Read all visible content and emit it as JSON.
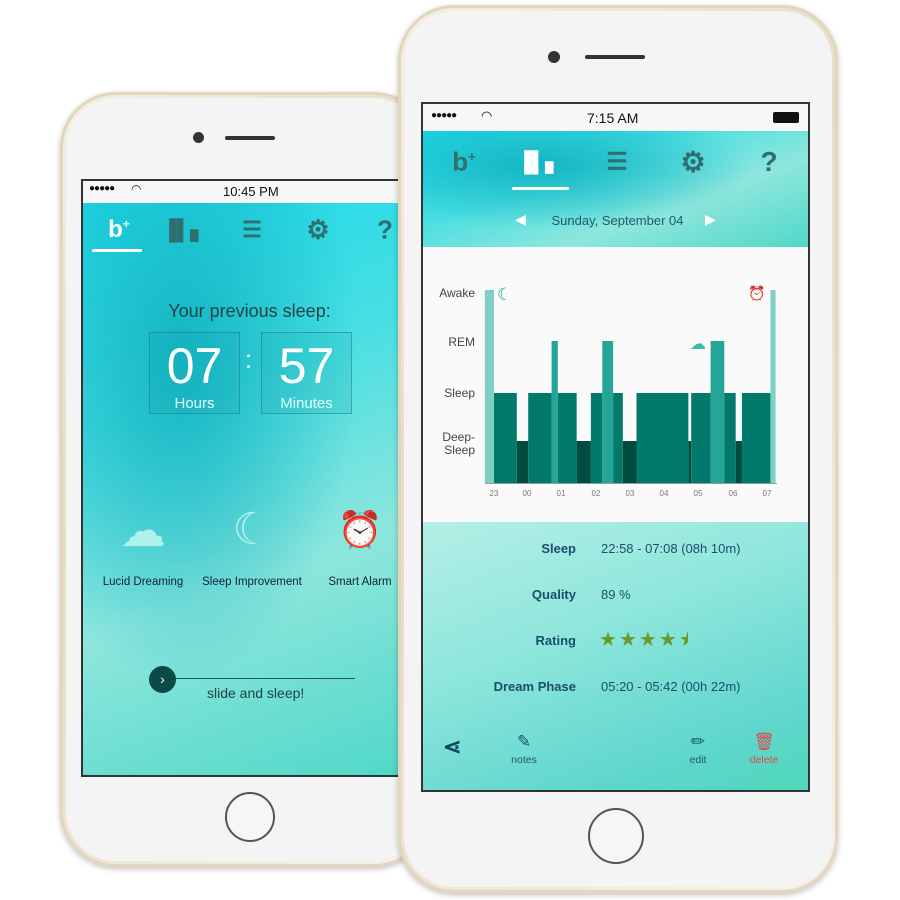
{
  "left_phone": {
    "status": {
      "time": "10:45 PM"
    },
    "nav": [
      "home-plus",
      "stats",
      "list",
      "settings",
      "help"
    ],
    "active_nav": "home-plus",
    "heading": "Your previous sleep:",
    "hours": {
      "value": "07",
      "label": "Hours"
    },
    "minutes": {
      "value": "57",
      "label": "Minutes"
    },
    "features": [
      {
        "label": "Lucid Dreaming",
        "icon": "cloud-icon"
      },
      {
        "label": "Sleep Improvement",
        "icon": "moon-icon"
      },
      {
        "label": "Smart Alarm",
        "icon": "alarm-clock-icon"
      }
    ],
    "slider_label": "slide and sleep!"
  },
  "right_phone": {
    "status": {
      "time": "7:15 AM"
    },
    "active_nav": "stats",
    "date": "Sunday, September 04",
    "chart": {
      "y_labels": [
        "Awake",
        "REM",
        "Sleep",
        "Deep-\nSleep"
      ],
      "x_labels": [
        "23",
        "00",
        "01",
        "02",
        "03",
        "04",
        "05",
        "06",
        "07"
      ],
      "colors": {
        "Awake": "#7fcfc4",
        "REM": "#25a597",
        "Sleep": "#017a6c",
        "Deep": "#004d40"
      }
    },
    "stats": [
      {
        "label": "Sleep",
        "value": "22:58 - 07:08  (08h 10m)"
      },
      {
        "label": "Quality",
        "value": "89 %"
      },
      {
        "label": "Rating",
        "value": "",
        "stars": 4.5
      },
      {
        "label": "Dream Phase",
        "value": "05:20 - 05:42  (00h 22m)"
      }
    ],
    "toolbar": {
      "notes": "notes",
      "edit": "edit",
      "delete": "delete"
    },
    "accent": {
      "stars": "#6a9a2a",
      "delete": "#e04848"
    }
  },
  "chart_data": {
    "type": "bar",
    "x_unit": "clock time",
    "categories": [
      "Awake",
      "REM",
      "Sleep",
      "Deep-Sleep"
    ],
    "segments": [
      [
        "22:44",
        "23:00",
        "Awake"
      ],
      [
        "23:00",
        "23:40",
        "Sleep"
      ],
      [
        "23:40",
        "00:00",
        "Deep"
      ],
      [
        "00:00",
        "00:41",
        "Sleep"
      ],
      [
        "00:41",
        "00:52",
        "REM"
      ],
      [
        "00:52",
        "01:25",
        "Sleep"
      ],
      [
        "01:25",
        "01:50",
        "Deep"
      ],
      [
        "01:50",
        "02:10",
        "Sleep"
      ],
      [
        "02:10",
        "02:29",
        "REM"
      ],
      [
        "02:29",
        "02:46",
        "Sleep"
      ],
      [
        "02:46",
        "03:10",
        "Deep"
      ],
      [
        "03:10",
        "04:41",
        "Sleep"
      ],
      [
        "04:41",
        "04:46",
        "Deep"
      ],
      [
        "04:46",
        "05:20",
        "Sleep"
      ],
      [
        "05:20",
        "05:44",
        "REM"
      ],
      [
        "05:44",
        "06:04",
        "Sleep"
      ],
      [
        "06:04",
        "06:15",
        "Deep"
      ],
      [
        "06:15",
        "07:05",
        "Sleep"
      ],
      [
        "07:05",
        "07:14",
        "Awake"
      ]
    ]
  }
}
